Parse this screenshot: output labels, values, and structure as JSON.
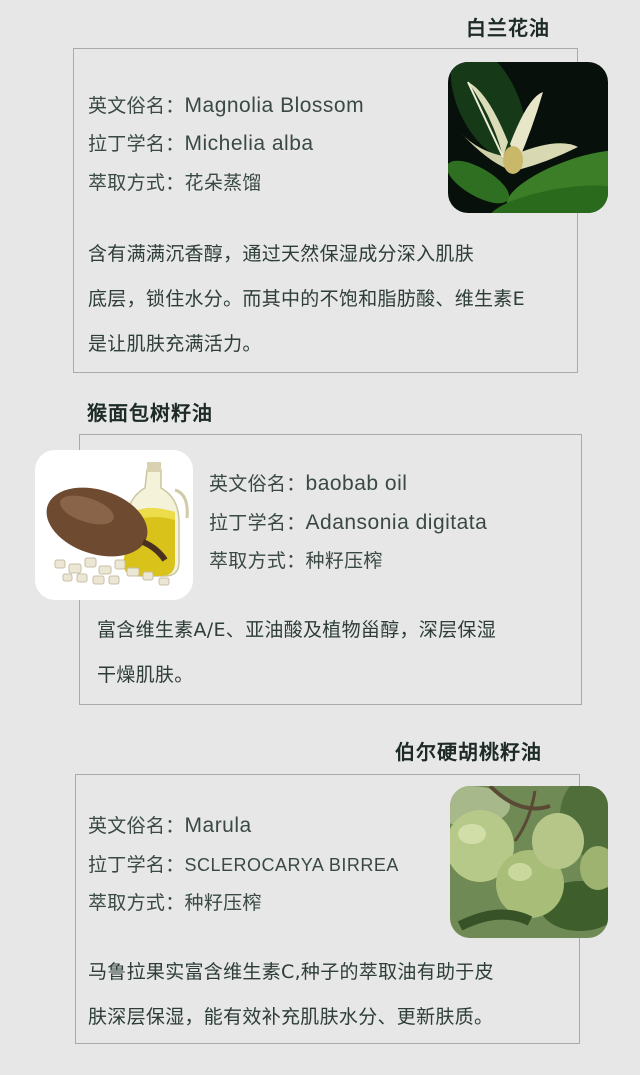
{
  "sections": [
    {
      "title": "白兰花油",
      "fields": [
        {
          "key": "英文俗名：",
          "value": "Magnolia Blossom"
        },
        {
          "key": "拉丁学名：",
          "value": "Michelia alba"
        },
        {
          "key": "萃取方式：",
          "value": "花朵蒸馏"
        }
      ],
      "description": [
        "含有满满沉香醇，通过天然保湿成分深入肌肤",
        "底层，锁住水分。而其中的不饱和脂肪酸、维生素E",
        "是让肌肤充满活力。"
      ],
      "image_icon": "magnolia-flower"
    },
    {
      "title": "猴面包树籽油",
      "fields": [
        {
          "key": "英文俗名：",
          "value": "baobab oil"
        },
        {
          "key": "拉丁学名：",
          "value": "Adansonia digitata"
        },
        {
          "key": "萃取方式：",
          "value": "种籽压榨"
        }
      ],
      "description": [
        "富含维生素A/E、亚油酸及植物甾醇，深层保湿",
        "干燥肌肤。"
      ],
      "image_icon": "baobab-fruit-and-oil"
    },
    {
      "title": "伯尔硬胡桃籽油",
      "fields": [
        {
          "key": "英文俗名：",
          "value": "Marula"
        },
        {
          "key": "拉丁学名：",
          "value": "SCLEROCARYA BIRREA"
        },
        {
          "key": "萃取方式：",
          "value": "种籽压榨"
        }
      ],
      "description": [
        "马鲁拉果实富含维生素C,种子的萃取油有助于皮",
        "肤深层保湿，能有效补充肌肤水分、更新肤质。"
      ],
      "image_icon": "marula-fruits"
    }
  ],
  "colors": {
    "background": "#e6e7e6",
    "border": "#a9aaa9",
    "text": "#2e3d38"
  }
}
